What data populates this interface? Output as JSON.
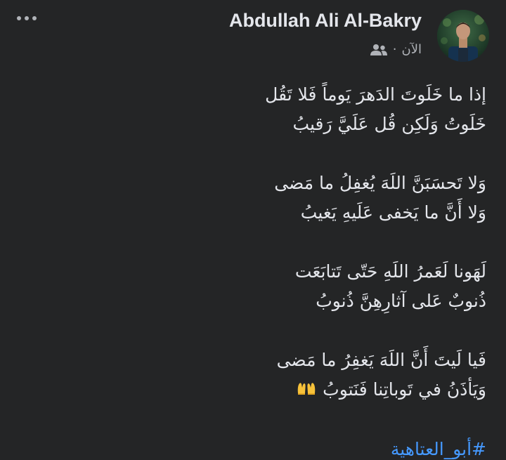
{
  "post": {
    "author_name": "Abdullah Ali Al-Bakry",
    "timestamp": "الآن",
    "separator": "·",
    "audience_icon": "friends-icon",
    "more_icon": "more-options-icon",
    "avatar_icon": "profile-photo"
  },
  "poem": {
    "stanzas": [
      {
        "lines": [
          "إذا ما خَلَوتَ الدَهرَ يَوماً فَلا تَقُل",
          "خَلَوتُ وَلَكِن قُل عَلَيَّ رَقيبُ"
        ]
      },
      {
        "lines": [
          "وَلا تَحسَبَنَّ اللَهَ يُغفِلُ ما مَضى",
          "وَلا أَنَّ ما يَخفى عَلَيهِ يَغيبُ"
        ]
      },
      {
        "lines": [
          "لَهَونا لَعَمرُ اللَهِ حَتّى تَتابَعَت",
          "ذُنوبٌ عَلى آثارِهِنَّ ذُنوبُ"
        ]
      },
      {
        "lines": [
          "فَيا لَيتَ أَنَّ اللَهَ يَغفِرُ ما مَضى",
          "وَيَأذَنُ في تَوباتِنا فَنَتوبُ"
        ]
      }
    ],
    "emoji": "🤲",
    "hashtag": "#أبو_العتاهية"
  }
}
